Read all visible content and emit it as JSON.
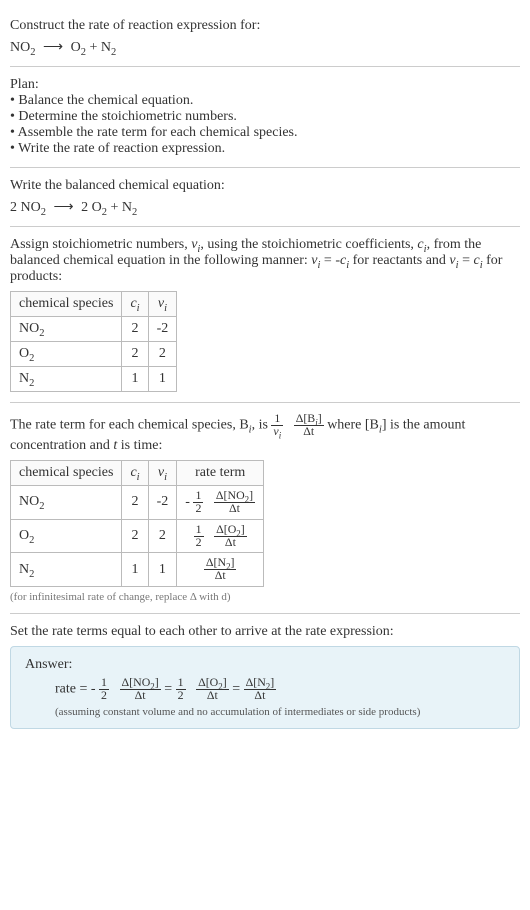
{
  "prompt": {
    "line1": "Construct the rate of reaction expression for:",
    "equation_lhs": "NO",
    "equation_arrow": "⟶",
    "equation_rhs_a": "O",
    "equation_plus": " + N"
  },
  "plan": {
    "heading": "Plan:",
    "b1": "• Balance the chemical equation.",
    "b2": "• Determine the stoichiometric numbers.",
    "b3": "• Assemble the rate term for each chemical species.",
    "b4": "• Write the rate of reaction expression."
  },
  "balanced": {
    "heading": "Write the balanced chemical equation:",
    "lhs_coef": "2 NO",
    "arrow": "⟶",
    "rhs1_coef": "2 O",
    "plus": " + N"
  },
  "stoich_intro_a": "Assign stoichiometric numbers, ",
  "stoich_intro_b": ", using the stoichiometric coefficients, ",
  "stoich_intro_c": ", from the balanced chemical equation in the following manner: ",
  "stoich_intro_d": " for reactants and ",
  "stoich_intro_e": " for products:",
  "nu_i": "ν",
  "c_i": "c",
  "i_sub": "i",
  "eq1": " = -",
  "eq2": " = ",
  "table1": {
    "h1": "chemical species",
    "h2": "c",
    "h3": "ν",
    "r1c1": "NO",
    "r1c2": "2",
    "r1c3": "-2",
    "r2c1": "O",
    "r2c2": "2",
    "r2c3": "2",
    "r3c1": "N",
    "r3c2": "1",
    "r3c3": "1"
  },
  "rateterm_intro_a": "The rate term for each chemical species, B",
  "rateterm_intro_b": ", is ",
  "rateterm_intro_c": " where [B",
  "rateterm_intro_d": "] is the amount concentration and ",
  "rateterm_intro_e": " is time:",
  "t_var": "t",
  "frac_one": "1",
  "frac_nu": "ν",
  "delta": "Δ",
  "conc_B": "[B",
  "close_br": "]",
  "delta_t": "Δt",
  "table2": {
    "h1": "chemical species",
    "h2": "c",
    "h3": "ν",
    "h4": "rate term",
    "r1c1": "NO",
    "r1c2": "2",
    "r1c3": "-2",
    "r2c1": "O",
    "r2c2": "2",
    "r2c3": "2",
    "r3c1": "N",
    "r3c2": "1",
    "r3c3": "1",
    "half": "2",
    "minus": "-",
    "conc_no2": "Δ[NO",
    "conc_o2": "Δ[O",
    "conc_n2": "Δ[N"
  },
  "note1": "(for infinitesimal rate of change, replace Δ with d)",
  "final_heading": "Set the rate terms equal to each other to arrive at the rate expression:",
  "answer": {
    "heading": "Answer:",
    "rate_eq": "rate = ",
    "minus": "-",
    "one": "1",
    "two": "2",
    "eq": " = ",
    "note": "(assuming constant volume and no accumulation of intermediates or side products)"
  }
}
